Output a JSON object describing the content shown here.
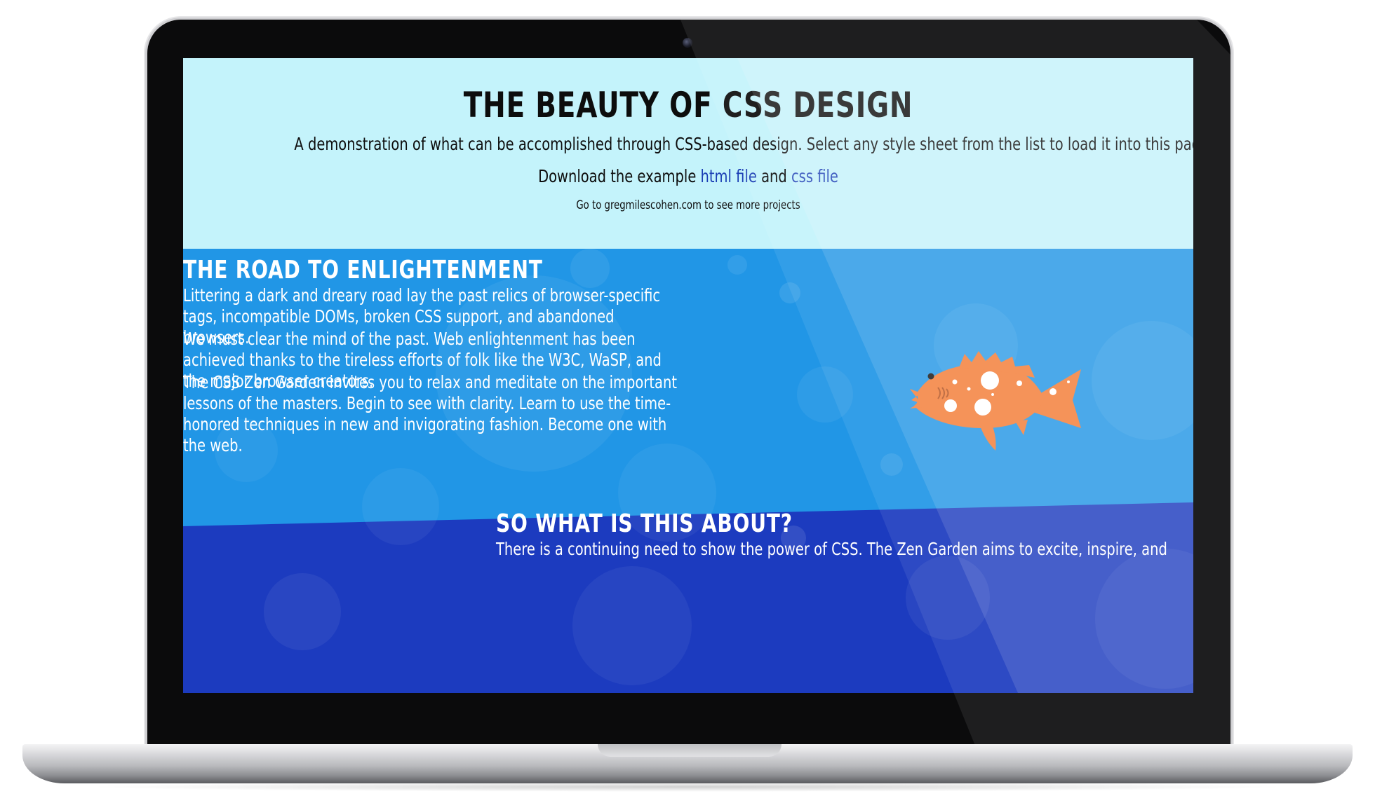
{
  "page": {
    "title": "THE BEAUTY OF CSS DESIGN",
    "subtitle": "A demonstration of what can be accomplished through CSS-based design. Select any style sheet from the list to load it into this page.",
    "download": {
      "prefix": "Download the example ",
      "html_link": "html file",
      "conjunction": " and ",
      "css_link": "css file"
    },
    "projects_text": "Go to gregmilescohen.com to see more projects"
  },
  "sections": [
    {
      "title": "THE ROAD TO ENLIGHTENMENT",
      "paragraphs": [
        "Littering a dark and dreary road lay the past relics of browser-specific tags, incompatible DOMs, broken CSS support, and abandoned browsers.",
        "We must clear the mind of the past. Web enlightenment has been achieved thanks to the tireless efforts of folk like the W3C, WaSP, and the major browser creators.",
        "The CSS Zen Garden invites you to relax and meditate on the important lessons of the masters. Begin to see with clarity. Learn to use the time-honored techniques in new and invigorating fashion. Become one with the web."
      ]
    },
    {
      "title": "SO WHAT IS THIS ABOUT?",
      "paragraphs": [
        "There is a continuing need to show the power of CSS. The Zen Garden aims to excite, inspire, and"
      ]
    }
  ],
  "colors": {
    "hero_bg": "#c4f3fb",
    "mid_bg": "#2196e6",
    "lower_bg": "#1c3bbf",
    "link": "#1a3db4",
    "fish": "#f47a33"
  },
  "icons": {
    "fish": "orange-fish-illustration"
  }
}
